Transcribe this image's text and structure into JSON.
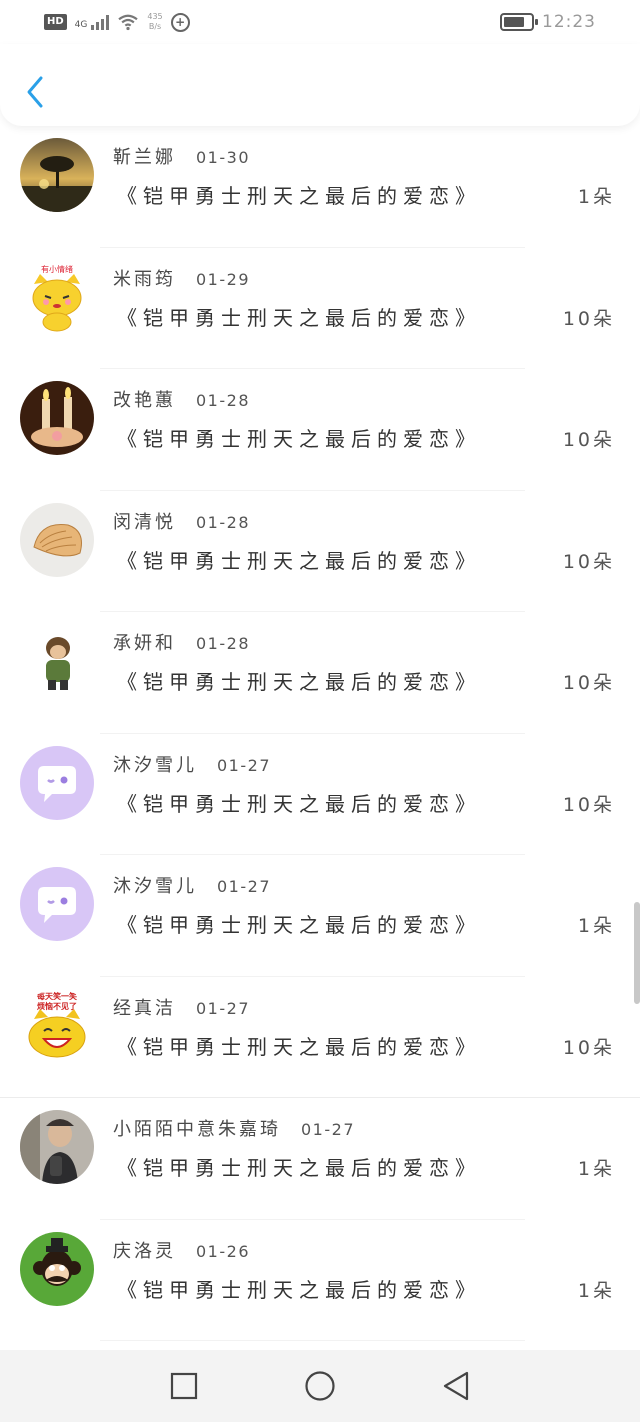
{
  "status_bar": {
    "hd": "HD",
    "network": "4G",
    "speed_value": "435",
    "speed_unit": "B/s",
    "time": "12:23",
    "battery_level": 0.75
  },
  "header": {
    "back_icon": "chevron-left-icon",
    "accent_color": "#2aa0e8"
  },
  "list": {
    "items": [
      {
        "name": "靳兰娜",
        "date": "01-30",
        "title": "《铠甲勇士刑天之最后的爱恋》",
        "count": "1朵",
        "avatar": "sunset-tree-photo"
      },
      {
        "name": "米雨筠",
        "date": "01-29",
        "title": "《铠甲勇士刑天之最后的爱恋》",
        "count": "10朵",
        "avatar": "yellow-cat-sticker"
      },
      {
        "name": "改艳蕙",
        "date": "01-28",
        "title": "《铠甲勇士刑天之最后的爱恋》",
        "count": "10朵",
        "avatar": "candles-photo"
      },
      {
        "name": "闵清悦",
        "date": "01-28",
        "title": "《铠甲勇士刑天之最后的爱恋》",
        "count": "10朵",
        "avatar": "shell-photo"
      },
      {
        "name": "承妍和",
        "date": "01-28",
        "title": "《铠甲勇士刑天之最后的爱恋》",
        "count": "10朵",
        "avatar": "cartoon-figure"
      },
      {
        "name": "沐汐雪儿",
        "date": "01-27",
        "title": "《铠甲勇士刑天之最后的爱恋》",
        "count": "10朵",
        "avatar": "chat-bubble-default"
      },
      {
        "name": "沐汐雪儿",
        "date": "01-27",
        "title": "《铠甲勇士刑天之最后的爱恋》",
        "count": "1朵",
        "avatar": "chat-bubble-default"
      },
      {
        "name": "经真洁",
        "date": "01-27",
        "title": "《铠甲勇士刑天之最后的爱恋》",
        "count": "10朵",
        "avatar": "laughing-cat-sticker"
      },
      {
        "name": "小陌陌中意朱嘉琦",
        "date": "01-27",
        "title": "《铠甲勇士刑天之最后的爱恋》",
        "count": "1朵",
        "avatar": "person-photo"
      },
      {
        "name": "庆洛灵",
        "date": "01-26",
        "title": "《铠甲勇士刑天之最后的爱恋》",
        "count": "1朵",
        "avatar": "monkey-face"
      }
    ]
  },
  "bottom_nav": {
    "recents_icon": "square-icon",
    "home_icon": "circle-icon",
    "back_icon": "triangle-back-icon"
  }
}
